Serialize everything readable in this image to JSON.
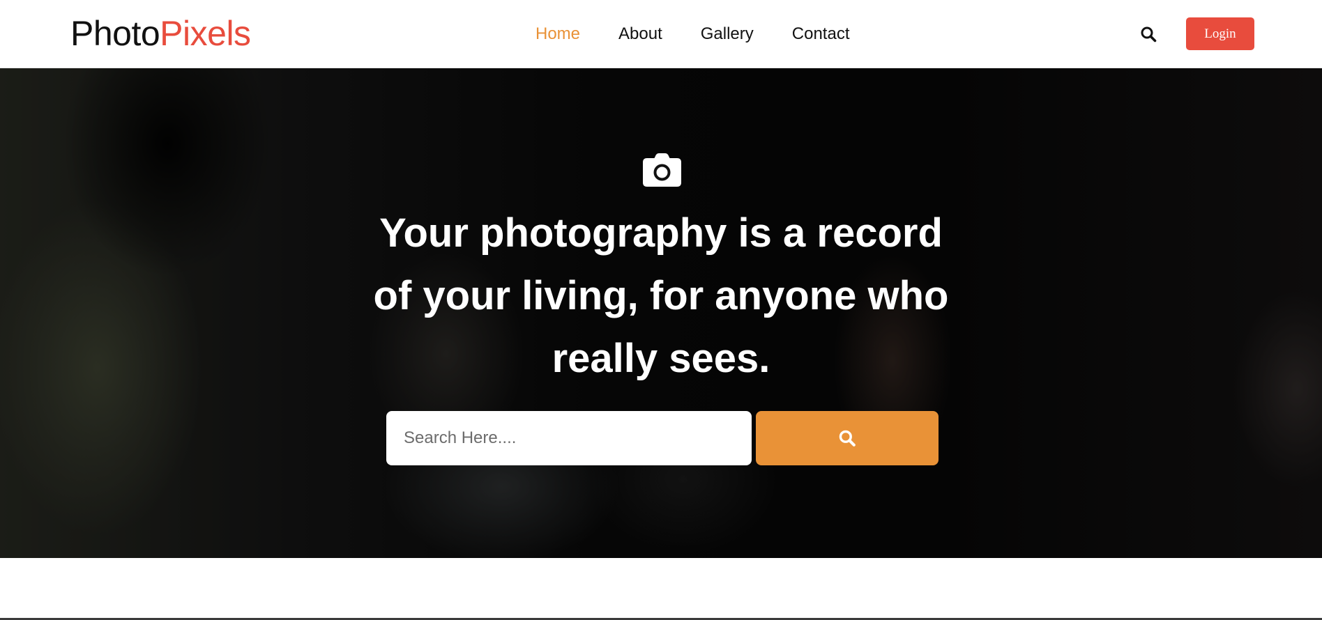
{
  "brand": {
    "part1": "Photo",
    "part2": "Pixels"
  },
  "nav": {
    "items": [
      {
        "label": "Home",
        "active": true
      },
      {
        "label": "About",
        "active": false
      },
      {
        "label": "Gallery",
        "active": false
      },
      {
        "label": "Contact",
        "active": false
      }
    ],
    "search_icon": "search-icon",
    "login_label": "Login"
  },
  "hero": {
    "icon": "camera-icon",
    "title_line1": "Your photography is a record",
    "title_line2": "of your living, for anyone who",
    "title_line3": "really sees.",
    "search": {
      "placeholder": "Search Here....",
      "value": "",
      "button_icon": "search-icon"
    }
  },
  "colors": {
    "accent_orange": "#e99237",
    "brand_red": "#e84c3d",
    "text_dark": "#111111"
  }
}
